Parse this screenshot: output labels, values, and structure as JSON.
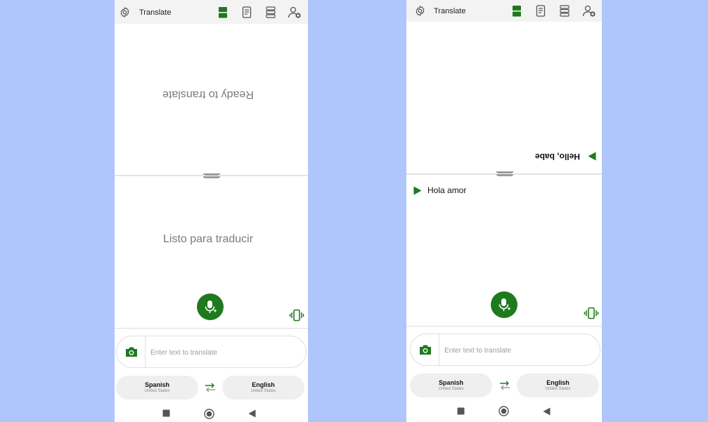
{
  "colors": {
    "accent": "#1e7a1e",
    "background": "#aec6fc"
  },
  "screens": [
    {
      "app_title": "Translate",
      "top_status": "Ready to translate",
      "bottom_status": "Listo para traducir",
      "input_placeholder": "Enter text to translate",
      "source_lang": {
        "name": "Spanish",
        "region": "United States"
      },
      "target_lang": {
        "name": "English",
        "region": "United States"
      }
    },
    {
      "app_title": "Translate",
      "top_message": "Hello, babe",
      "bottom_message": "Hola amor",
      "input_placeholder": "Enter text to translate",
      "source_lang": {
        "name": "Spanish",
        "region": "United States"
      },
      "target_lang": {
        "name": "English",
        "region": "United States"
      }
    }
  ],
  "icons": {
    "topbar": [
      "gear-icon",
      "split-view-icon",
      "document-icon",
      "list-view-icon",
      "add-user-icon"
    ],
    "input": "camera-icon",
    "actions": [
      "mic-icon",
      "vibrate-icon",
      "swap-icon",
      "play-icon"
    ],
    "nav": [
      "nav-square-icon",
      "nav-home-icon",
      "nav-back-icon"
    ]
  }
}
